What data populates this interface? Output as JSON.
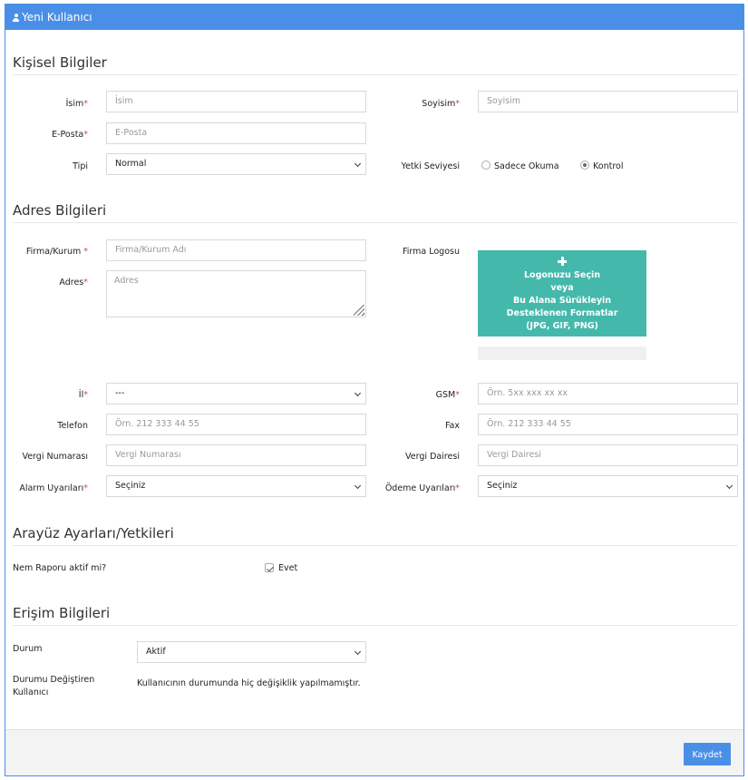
{
  "header": {
    "title": "Yeni Kullanıcı",
    "icon": "user-icon"
  },
  "personal": {
    "section_title": "Kişisel Bilgiler",
    "name_label": "İsim",
    "name_placeholder": "İsim",
    "surname_label": "Soyisim",
    "surname_placeholder": "Soyisim",
    "email_label": "E-Posta",
    "email_placeholder": "E-Posta",
    "type_label": "Tipi",
    "type_value": "Normal",
    "auth_label": "Yetki Seviyesi",
    "auth_options": [
      "Sadece Okuma",
      "Kontrol"
    ],
    "auth_selected": "Kontrol"
  },
  "address": {
    "section_title": "Adres Bilgileri",
    "company_label": "Firma/Kurum",
    "company_placeholder": "Firma/Kurum Adı",
    "address_label": "Adres",
    "address_placeholder": "Adres",
    "logo_label": "Firma Logosu",
    "upload_lines": [
      "Logonuzu Seçin",
      "veya",
      "Bu Alana Sürükleyin",
      "Desteklenen Formatlar",
      "(JPG, GIF, PNG)"
    ],
    "city_label": "İl",
    "city_value": "---",
    "gsm_label": "GSM",
    "gsm_placeholder": "Örn. 5xx xxx xx xx",
    "phone_label": "Telefon",
    "phone_placeholder": "Örn. 212 333 44 55",
    "fax_label": "Fax",
    "fax_placeholder": "Örn. 212 333 44 55",
    "tax_number_label": "Vergi Numarası",
    "tax_number_placeholder": "Vergi Numarası",
    "tax_office_label": "Vergi Dairesi",
    "tax_office_placeholder": "Vergi Dairesi",
    "alarm_label": "Alarm Uyarıları",
    "alarm_value": "Seçiniz",
    "payment_label": "Ödeme Uyarıları",
    "payment_value": "Seçiniz"
  },
  "interface": {
    "section_title": "Arayüz Ayarları/Yetkileri",
    "nem_label": "Nem Raporu aktif mi?",
    "nem_checkbox_label": "Evet",
    "nem_checked": true
  },
  "access": {
    "section_title": "Erişim Bilgileri",
    "status_label": "Durum",
    "status_value": "Aktif",
    "changer_label_line1": "Durumu Değiştiren",
    "changer_label_line2": "Kullanıcı",
    "changer_text": "Kullanıcının durumunda hiç değişiklik yapılmamıştır."
  },
  "footer": {
    "save_label": "Kaydet"
  },
  "colors": {
    "primary": "#4a8fe7",
    "upload_bg": "#45b8ac",
    "required": "#e0464b"
  }
}
